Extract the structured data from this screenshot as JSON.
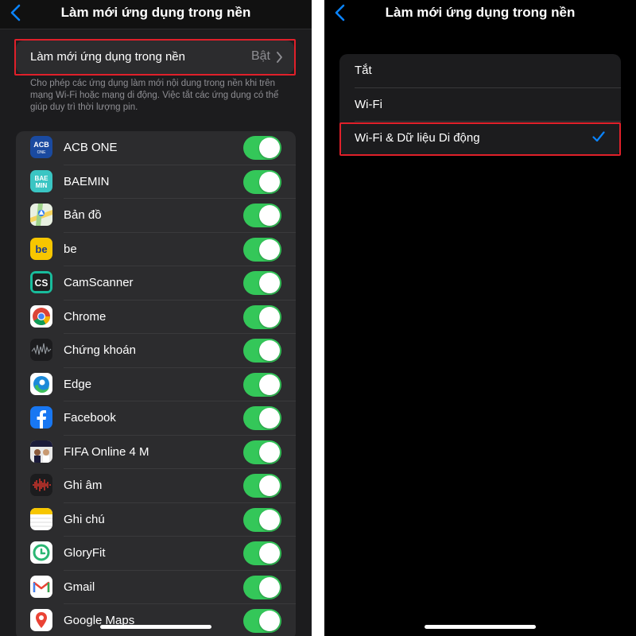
{
  "left": {
    "title": "Làm mới ứng dụng trong nền",
    "setting": {
      "label": "Làm mới ứng dụng trong nền",
      "value": "Bật"
    },
    "footnote": "Cho phép các ứng dụng làm mới nội dung trong nền khi trên mạng Wi-Fi hoặc mạng di động. Việc tắt các ứng dụng có thể giúp duy trì thời lượng pin.",
    "apps": [
      {
        "name": "ACB ONE",
        "icon": "acb-one-icon",
        "enabled": true
      },
      {
        "name": "BAEMIN",
        "icon": "baemin-icon",
        "enabled": true
      },
      {
        "name": "Bản đồ",
        "icon": "maps-icon",
        "enabled": true
      },
      {
        "name": "be",
        "icon": "be-icon",
        "enabled": true
      },
      {
        "name": "CamScanner",
        "icon": "camscanner-icon",
        "enabled": true
      },
      {
        "name": "Chrome",
        "icon": "chrome-icon",
        "enabled": true
      },
      {
        "name": "Chứng khoán",
        "icon": "stocks-icon",
        "enabled": true
      },
      {
        "name": "Edge",
        "icon": "edge-icon",
        "enabled": true
      },
      {
        "name": "Facebook",
        "icon": "facebook-icon",
        "enabled": true
      },
      {
        "name": "FIFA Online 4 M",
        "icon": "fifa-icon",
        "enabled": true
      },
      {
        "name": "Ghi âm",
        "icon": "voice-memos-icon",
        "enabled": true
      },
      {
        "name": "Ghi chú",
        "icon": "notes-icon",
        "enabled": true
      },
      {
        "name": "GloryFit",
        "icon": "gloryfit-icon",
        "enabled": true
      },
      {
        "name": "Gmail",
        "icon": "gmail-icon",
        "enabled": true
      },
      {
        "name": "Google Maps",
        "icon": "google-maps-icon",
        "enabled": true
      }
    ],
    "icon_text": {
      "acb": "ACB",
      "acb_sub": "ONE",
      "baemin_1": "BAE",
      "baemin_2": "MIN",
      "be": "be",
      "cs": "CS"
    }
  },
  "right": {
    "title": "Làm mới ứng dụng trong nền",
    "options": [
      {
        "label": "Tắt",
        "selected": false
      },
      {
        "label": "Wi-Fi",
        "selected": false
      },
      {
        "label": "Wi-Fi & Dữ liệu Di động",
        "selected": true
      }
    ]
  },
  "colors": {
    "accent": "#0a84ff",
    "toggle_on": "#34c759",
    "highlight": "#e0202a"
  }
}
